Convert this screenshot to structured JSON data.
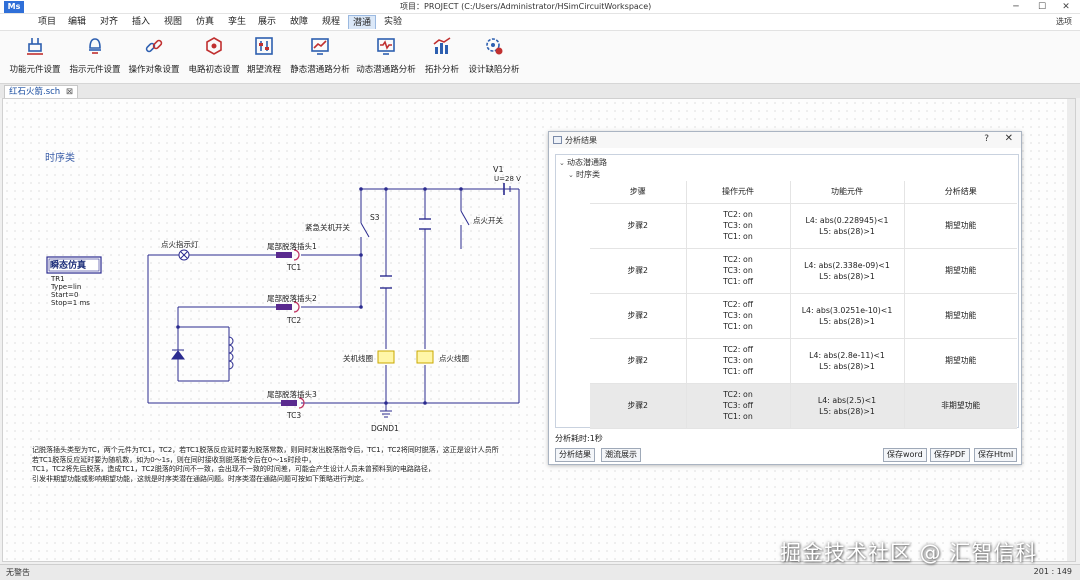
{
  "titlebar": {
    "logo": "Ms",
    "title": "项目：PROJECT (C:/Users/Administrator/HSimCircuitWorkspace)"
  },
  "menu": {
    "items": [
      "项目",
      "编辑",
      "对齐",
      "插入",
      "视图",
      "仿真",
      "孪生",
      "展示",
      "故障",
      "规程",
      "潜通",
      "实验"
    ],
    "active_index": 10,
    "view_option": "选项"
  },
  "ribbon": {
    "buttons": [
      {
        "label": "功能元件设置",
        "icon": "component-icon"
      },
      {
        "label": "指示元件设置",
        "icon": "indicator-bulb-icon"
      },
      {
        "label": "操作对象设置",
        "icon": "link-icon"
      },
      {
        "label": "电路初态设置",
        "icon": "cube-icon"
      },
      {
        "label": "期望流程",
        "icon": "sliders-icon"
      },
      {
        "label": "静态潜通路分析",
        "icon": "static-analysis-icon"
      },
      {
        "label": "动态潜通路分析",
        "icon": "dynamic-analysis-icon"
      },
      {
        "label": "拓扑分析",
        "icon": "bar-chart-icon"
      },
      {
        "label": "设计缺陷分析",
        "icon": "defect-gear-icon"
      }
    ]
  },
  "document_tab": {
    "label": "红石火箭.sch",
    "close": "⊠"
  },
  "schematic": {
    "heading": "时序类",
    "sim_box": {
      "label": "瞬态仿真",
      "lines": [
        "TR1",
        "Type=lin",
        "Start=0",
        "Stop=1 ms"
      ]
    },
    "labels": {
      "ignition_lamp": "点火指示灯",
      "emergency_switch": "紧急关机开关",
      "ignition_switch": "点火开关",
      "s3": "S3",
      "v1": "V1",
      "u": "U=28 V",
      "plug1": "尾部脱落插头1",
      "tc1": "TC1",
      "plug2": "尾部脱落插头2",
      "tc2": "TC2",
      "plug3": "尾部脱落插头3",
      "tc3": "TC3",
      "shutdown_coil": "关机线圈",
      "ignition_coil": "点火线圈",
      "ground": "DGND1"
    },
    "description": [
      "记脱落插头类型为TC，两个元件为TC1，TC2，若TC1脱落反应延时要为脱落常数，则同时发出脱落指令后，TC1，TC2将同时脱落，这正是设计人员所",
      "若TC1脱落反应延时要为随机数，如为0～1s，则在同时接收到脱落指令后在0～1s时段中，",
      "TC1，TC2将先后脱落，造成TC1，TC2脱落的时间不一致，会出现不一致的时间差，可能会产生设计人员未曾预料到的电路路径，",
      "引发非期望功能或影响期望功能，这就是时序类潜在通路问题。时序类潜在通路问题可按如下策略进行判定。"
    ]
  },
  "dialog": {
    "title": "分析结果",
    "help": "?",
    "close": "✕",
    "tree_root": "动态潜通路",
    "tree_child": "时序类",
    "columns": [
      "步骤",
      "操作元件",
      "功能元件",
      "分析结果"
    ],
    "rows": [
      {
        "step": "步骤2",
        "ops": [
          "TC2: on",
          "TC3: on",
          "TC1: on"
        ],
        "funcs": [
          "L4: abs(0.228945)<1",
          "L5: abs(28)>1"
        ],
        "result": "期望功能",
        "selected": false
      },
      {
        "step": "步骤2",
        "ops": [
          "TC2: on",
          "TC3: on",
          "TC1: off"
        ],
        "funcs": [
          "L4: abs(2.338e-09)<1",
          "L5: abs(28)>1"
        ],
        "result": "期望功能",
        "selected": false
      },
      {
        "step": "步骤2",
        "ops": [
          "TC2: off",
          "TC3: on",
          "TC1: on"
        ],
        "funcs": [
          "L4: abs(3.0251e-10)<1",
          "L5: abs(28)>1"
        ],
        "result": "期望功能",
        "selected": false
      },
      {
        "step": "步骤2",
        "ops": [
          "TC2: off",
          "TC3: on",
          "TC1: off"
        ],
        "funcs": [
          "L4: abs(2.8e-11)<1",
          "L5: abs(28)>1"
        ],
        "result": "期望功能",
        "selected": false
      },
      {
        "step": "步骤2",
        "ops": [
          "TC2: on",
          "TC3: off",
          "TC1: on"
        ],
        "funcs": [
          "L4: abs(2.5)<1",
          "L5: abs(28)>1"
        ],
        "result": "非期望功能",
        "selected": true
      }
    ],
    "elapsed": "分析耗时:1秒",
    "buttons_left": [
      "分析结果",
      "潮流展示"
    ],
    "buttons_right": [
      "保存word",
      "保存PDF",
      "保存Html"
    ]
  },
  "status": {
    "left": "无警告",
    "right": "201 : 149"
  },
  "watermark": "掘金技术社区 @ 汇智信科",
  "colors": {
    "accent": "#2f6fd8",
    "wire": "#2b2b8f",
    "coil": "#fff6a8",
    "ribbon_icon": "#2d5fb0",
    "ribbon_icon_red": "#c03030"
  }
}
